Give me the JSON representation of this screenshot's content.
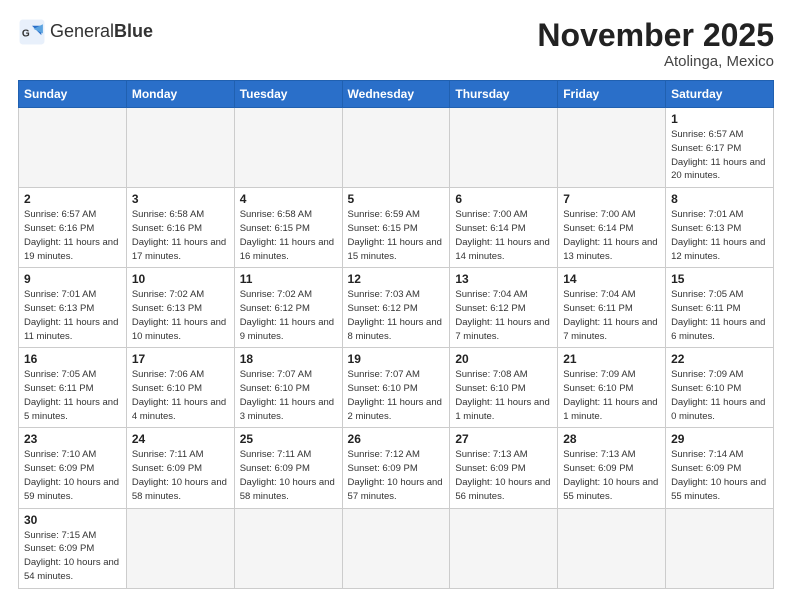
{
  "logo": {
    "text_normal": "General",
    "text_bold": "Blue"
  },
  "header": {
    "month_year": "November 2025",
    "location": "Atolinga, Mexico"
  },
  "weekdays": [
    "Sunday",
    "Monday",
    "Tuesday",
    "Wednesday",
    "Thursday",
    "Friday",
    "Saturday"
  ],
  "weeks": [
    [
      {
        "day": "",
        "info": "",
        "empty": true
      },
      {
        "day": "",
        "info": "",
        "empty": true
      },
      {
        "day": "",
        "info": "",
        "empty": true
      },
      {
        "day": "",
        "info": "",
        "empty": true
      },
      {
        "day": "",
        "info": "",
        "empty": true
      },
      {
        "day": "",
        "info": "",
        "empty": true
      },
      {
        "day": "1",
        "info": "Sunrise: 6:57 AM\nSunset: 6:17 PM\nDaylight: 11 hours\nand 20 minutes."
      }
    ],
    [
      {
        "day": "2",
        "info": "Sunrise: 6:57 AM\nSunset: 6:16 PM\nDaylight: 11 hours\nand 19 minutes."
      },
      {
        "day": "3",
        "info": "Sunrise: 6:58 AM\nSunset: 6:16 PM\nDaylight: 11 hours\nand 17 minutes."
      },
      {
        "day": "4",
        "info": "Sunrise: 6:58 AM\nSunset: 6:15 PM\nDaylight: 11 hours\nand 16 minutes."
      },
      {
        "day": "5",
        "info": "Sunrise: 6:59 AM\nSunset: 6:15 PM\nDaylight: 11 hours\nand 15 minutes."
      },
      {
        "day": "6",
        "info": "Sunrise: 7:00 AM\nSunset: 6:14 PM\nDaylight: 11 hours\nand 14 minutes."
      },
      {
        "day": "7",
        "info": "Sunrise: 7:00 AM\nSunset: 6:14 PM\nDaylight: 11 hours\nand 13 minutes."
      },
      {
        "day": "8",
        "info": "Sunrise: 7:01 AM\nSunset: 6:13 PM\nDaylight: 11 hours\nand 12 minutes."
      }
    ],
    [
      {
        "day": "9",
        "info": "Sunrise: 7:01 AM\nSunset: 6:13 PM\nDaylight: 11 hours\nand 11 minutes."
      },
      {
        "day": "10",
        "info": "Sunrise: 7:02 AM\nSunset: 6:13 PM\nDaylight: 11 hours\nand 10 minutes."
      },
      {
        "day": "11",
        "info": "Sunrise: 7:02 AM\nSunset: 6:12 PM\nDaylight: 11 hours\nand 9 minutes."
      },
      {
        "day": "12",
        "info": "Sunrise: 7:03 AM\nSunset: 6:12 PM\nDaylight: 11 hours\nand 8 minutes."
      },
      {
        "day": "13",
        "info": "Sunrise: 7:04 AM\nSunset: 6:12 PM\nDaylight: 11 hours\nand 7 minutes."
      },
      {
        "day": "14",
        "info": "Sunrise: 7:04 AM\nSunset: 6:11 PM\nDaylight: 11 hours\nand 7 minutes."
      },
      {
        "day": "15",
        "info": "Sunrise: 7:05 AM\nSunset: 6:11 PM\nDaylight: 11 hours\nand 6 minutes."
      }
    ],
    [
      {
        "day": "16",
        "info": "Sunrise: 7:05 AM\nSunset: 6:11 PM\nDaylight: 11 hours\nand 5 minutes."
      },
      {
        "day": "17",
        "info": "Sunrise: 7:06 AM\nSunset: 6:10 PM\nDaylight: 11 hours\nand 4 minutes."
      },
      {
        "day": "18",
        "info": "Sunrise: 7:07 AM\nSunset: 6:10 PM\nDaylight: 11 hours\nand 3 minutes."
      },
      {
        "day": "19",
        "info": "Sunrise: 7:07 AM\nSunset: 6:10 PM\nDaylight: 11 hours\nand 2 minutes."
      },
      {
        "day": "20",
        "info": "Sunrise: 7:08 AM\nSunset: 6:10 PM\nDaylight: 11 hours\nand 1 minute."
      },
      {
        "day": "21",
        "info": "Sunrise: 7:09 AM\nSunset: 6:10 PM\nDaylight: 11 hours\nand 1 minute."
      },
      {
        "day": "22",
        "info": "Sunrise: 7:09 AM\nSunset: 6:10 PM\nDaylight: 11 hours\nand 0 minutes."
      }
    ],
    [
      {
        "day": "23",
        "info": "Sunrise: 7:10 AM\nSunset: 6:09 PM\nDaylight: 10 hours\nand 59 minutes."
      },
      {
        "day": "24",
        "info": "Sunrise: 7:11 AM\nSunset: 6:09 PM\nDaylight: 10 hours\nand 58 minutes."
      },
      {
        "day": "25",
        "info": "Sunrise: 7:11 AM\nSunset: 6:09 PM\nDaylight: 10 hours\nand 58 minutes."
      },
      {
        "day": "26",
        "info": "Sunrise: 7:12 AM\nSunset: 6:09 PM\nDaylight: 10 hours\nand 57 minutes."
      },
      {
        "day": "27",
        "info": "Sunrise: 7:13 AM\nSunset: 6:09 PM\nDaylight: 10 hours\nand 56 minutes."
      },
      {
        "day": "28",
        "info": "Sunrise: 7:13 AM\nSunset: 6:09 PM\nDaylight: 10 hours\nand 55 minutes."
      },
      {
        "day": "29",
        "info": "Sunrise: 7:14 AM\nSunset: 6:09 PM\nDaylight: 10 hours\nand 55 minutes."
      }
    ],
    [
      {
        "day": "30",
        "info": "Sunrise: 7:15 AM\nSunset: 6:09 PM\nDaylight: 10 hours\nand 54 minutes."
      },
      {
        "day": "",
        "info": "",
        "empty": true
      },
      {
        "day": "",
        "info": "",
        "empty": true
      },
      {
        "day": "",
        "info": "",
        "empty": true
      },
      {
        "day": "",
        "info": "",
        "empty": true
      },
      {
        "day": "",
        "info": "",
        "empty": true
      },
      {
        "day": "",
        "info": "",
        "empty": true
      }
    ]
  ]
}
